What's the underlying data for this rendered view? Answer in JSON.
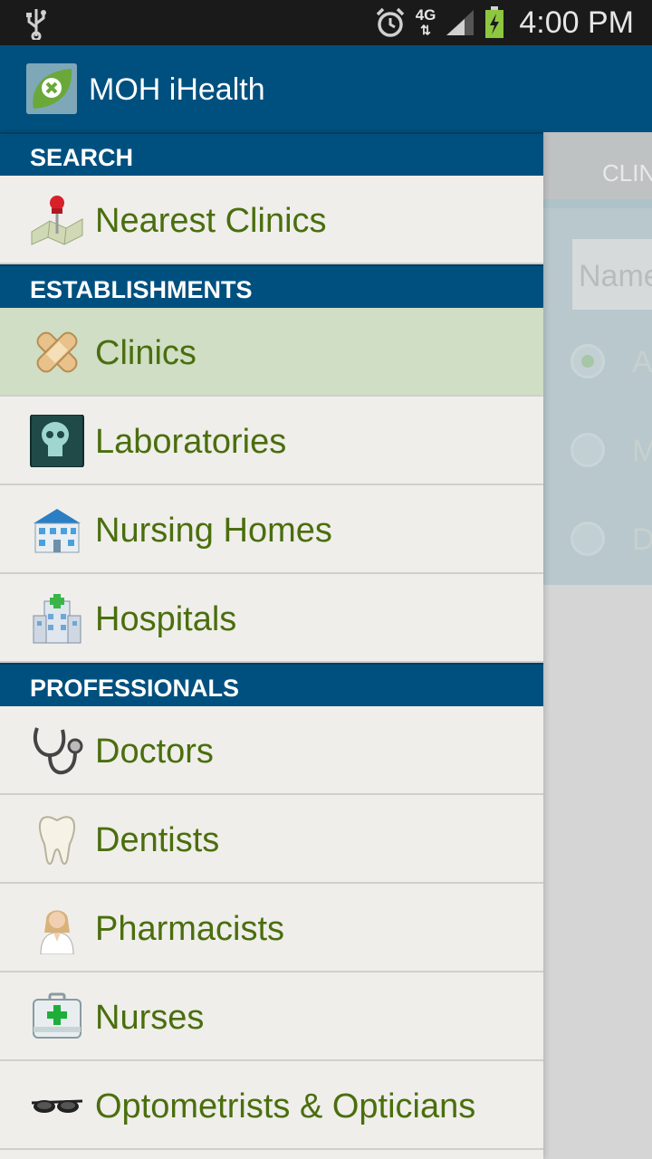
{
  "status_bar": {
    "time": "4:00 PM",
    "network": "4G"
  },
  "app": {
    "title": "MOH iHealth"
  },
  "drawer": {
    "sections": [
      {
        "title": "SEARCH",
        "items": [
          {
            "label": "Nearest Clinics",
            "icon": "map-pin-icon"
          }
        ]
      },
      {
        "title": "ESTABLISHMENTS",
        "items": [
          {
            "label": "Clinics",
            "icon": "bandage-icon",
            "selected": true
          },
          {
            "label": "Laboratories",
            "icon": "xray-icon"
          },
          {
            "label": "Nursing Homes",
            "icon": "nursing-home-icon"
          },
          {
            "label": "Hospitals",
            "icon": "hospital-icon"
          }
        ]
      },
      {
        "title": "PROFESSIONALS",
        "items": [
          {
            "label": "Doctors",
            "icon": "stethoscope-icon"
          },
          {
            "label": "Dentists",
            "icon": "tooth-icon"
          },
          {
            "label": "Pharmacists",
            "icon": "pharmacist-icon"
          },
          {
            "label": "Nurses",
            "icon": "first-aid-kit-icon"
          },
          {
            "label": "Optometrists & Opticians",
            "icon": "glasses-icon"
          }
        ]
      }
    ]
  },
  "background": {
    "tab_label": "CLIN",
    "search_placeholder": "Name",
    "radio_options": [
      "A",
      "M",
      "D"
    ]
  },
  "colors": {
    "header": "#00507f",
    "label_green": "#4a6e0d",
    "selected_bg": "#cfdec5"
  }
}
